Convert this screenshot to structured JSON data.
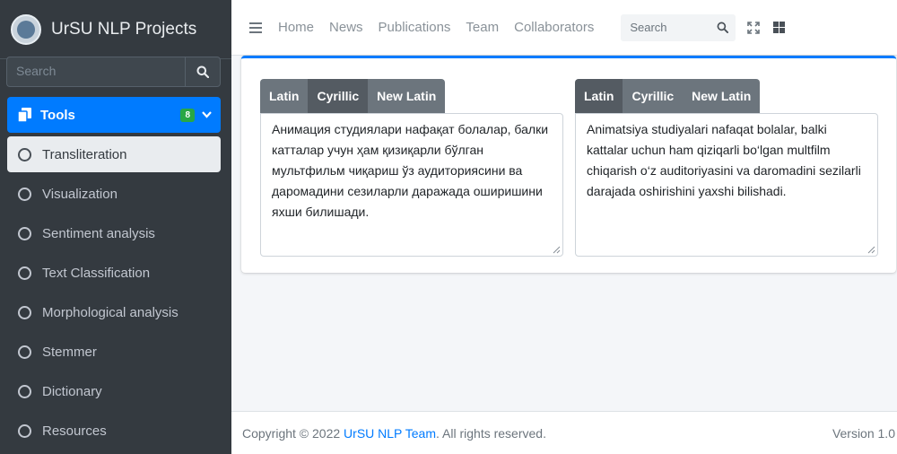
{
  "brand": {
    "title": "UrSU NLP Projects"
  },
  "sidebar": {
    "search_placeholder": "Search",
    "tools": {
      "label": "Tools",
      "badge": "8"
    },
    "items": [
      {
        "label": "Transliteration",
        "active": true
      },
      {
        "label": "Visualization"
      },
      {
        "label": "Sentiment analysis"
      },
      {
        "label": "Text Classification"
      },
      {
        "label": "Morphological analysis"
      },
      {
        "label": "Stemmer"
      },
      {
        "label": "Dictionary"
      },
      {
        "label": "Resources"
      }
    ]
  },
  "topnav": {
    "links": [
      "Home",
      "News",
      "Publications",
      "Team",
      "Collaborators"
    ],
    "search_placeholder": "Search"
  },
  "left_pane": {
    "tabs": [
      "Latin",
      "Cyrillic",
      "New Latin"
    ],
    "active_tab": "Cyrillic",
    "text": "Анимация студиялари нафақат болалар, балки катталар учун ҳам қизиқарли бўлган мультфильм чиқариш ўз аудиториясини ва даромадини сезиларли даражада оширишини яхши билишади."
  },
  "right_pane": {
    "tabs": [
      "Latin",
      "Cyrillic",
      "New Latin"
    ],
    "active_tab": "Latin",
    "text": "Animatsiya studiyalari nafaqat bolalar, balki kattalar uchun ham qiziqarli bo‘lgan multfilm chiqarish o‘z auditoriyasini va daromadini sezilarli darajada oshirishini yaxshi bilishadi."
  },
  "footer": {
    "prefix": "Copyright © 2022 ",
    "team": "UrSU NLP Team",
    "suffix": ". All rights reserved.",
    "version": "Version 1.0"
  },
  "colors": {
    "primary": "#007bff",
    "sidebar": "#343a40",
    "badge": "#28a745",
    "tab": "#6c757d"
  }
}
